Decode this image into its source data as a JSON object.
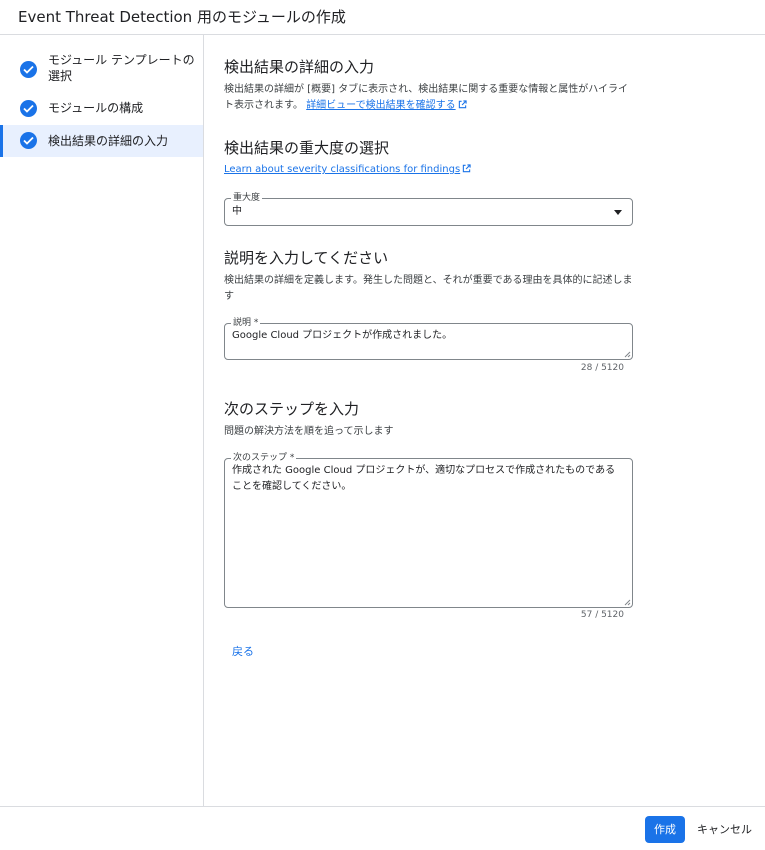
{
  "header": {
    "title": "Event Threat Detection 用のモジュールの作成"
  },
  "sidebar": {
    "steps": [
      {
        "label": "モジュール テンプレートの選択",
        "status": "complete"
      },
      {
        "label": "モジュールの構成",
        "status": "complete"
      },
      {
        "label": "検出結果の詳細の入力",
        "status": "complete",
        "active": true
      }
    ]
  },
  "main": {
    "finding_details": {
      "title": "検出結果の詳細の入力",
      "description": "検出結果の詳細が [概要] タブに表示され、検出結果に関する重要な情報と属性がハイライト表示されます。",
      "link": "詳細ビューで検出結果を確認する"
    },
    "severity": {
      "title": "検出結果の重大度の選択",
      "link": "Learn about severity classifications for findings",
      "field_label": "重大度",
      "value": "中"
    },
    "description": {
      "title": "説明を入力してください",
      "help": "検出結果の詳細を定義します。発生した問題と、それが重要である理由を具体的に記述します",
      "field_label": "説明 *",
      "value": "Google Cloud プロジェクトが作成されました。",
      "counter": "28 / 5120"
    },
    "next_steps": {
      "title": "次のステップを入力",
      "help": "問題の解決方法を順を追って示します",
      "field_label": "次のステップ *",
      "value": "作成された Google Cloud プロジェクトが、適切なプロセスで作成されたものであることを確認してください。",
      "counter": "57 / 5120"
    },
    "back_label": "戻る"
  },
  "footer": {
    "create_label": "作成",
    "cancel_label": "キャンセル"
  },
  "colors": {
    "accent": "#1a73e8",
    "active_bg": "#e8f0fe",
    "border": "#dadce0"
  },
  "icons": {
    "step_complete": "check-circle-icon",
    "external_link": "open-in-new-icon",
    "dropdown": "arrow-drop-down-icon"
  }
}
